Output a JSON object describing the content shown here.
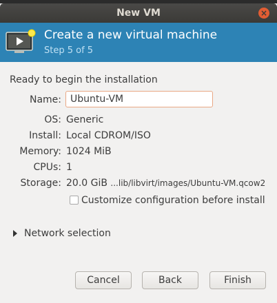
{
  "window": {
    "title": "New VM",
    "close_icon": "close-icon"
  },
  "banner": {
    "heading": "Create a new virtual machine",
    "step": "Step 5 of 5",
    "icon": "monitor-new-icon"
  },
  "summary": {
    "heading": "Ready to begin the installation",
    "name_label": "Name:",
    "name_value": "Ubuntu-VM",
    "os_label": "OS:",
    "os_value": "Generic",
    "install_label": "Install:",
    "install_value": "Local CDROM/ISO",
    "memory_label": "Memory:",
    "memory_value": "1024 MiB",
    "cpus_label": "CPUs:",
    "cpus_value": "1",
    "storage_label": "Storage:",
    "storage_size": "20.0 GiB",
    "storage_path": "...lib/libvirt/images/Ubuntu-VM.qcow2",
    "customize_label": "Customize configuration before install",
    "customize_checked": false
  },
  "network": {
    "label": "Network selection",
    "expanded": false
  },
  "buttons": {
    "cancel": "Cancel",
    "back": "Back",
    "finish": "Finish"
  },
  "colors": {
    "banner": "#2d83b5",
    "titlebar": "#3b3a37",
    "close": "#e25d33",
    "focus_border": "#e9a784"
  }
}
